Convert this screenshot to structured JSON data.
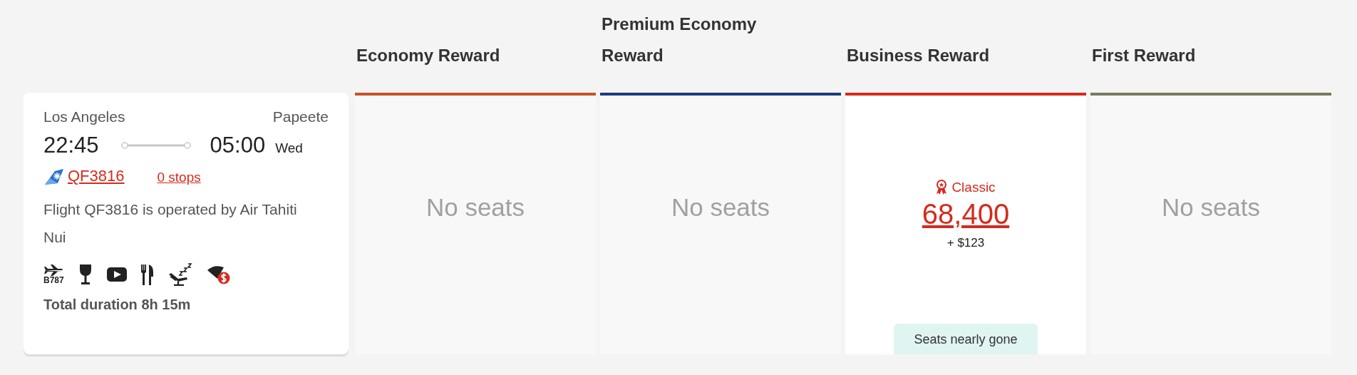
{
  "columns": [
    {
      "title": "Economy Reward",
      "color": "#c9522b"
    },
    {
      "title": "Premium Economy Reward",
      "color": "#1d3c7e"
    },
    {
      "title": "Business Reward",
      "color": "#d42b1e"
    },
    {
      "title": "First Reward",
      "color": "#7b7a5c"
    }
  ],
  "flight": {
    "origin": "Los Angeles",
    "destination": "Papeete",
    "depart_time": "22:45",
    "arrive_time": "05:00",
    "arrive_day": "Wed",
    "flight_number": "QF3816",
    "stops": "0 stops",
    "operated_by": "Flight QF3816 is operated by Air Tahiti Nui",
    "amenities": [
      {
        "kind": "aircraft",
        "label": "B787"
      },
      {
        "kind": "drink"
      },
      {
        "kind": "video"
      },
      {
        "kind": "meal"
      },
      {
        "kind": "sleep"
      },
      {
        "kind": "wifi_paid"
      }
    ],
    "total_duration": "Total duration 8h 15m"
  },
  "fares": [
    {
      "kind": "none",
      "text": "No seats"
    },
    {
      "kind": "none",
      "text": "No seats"
    },
    {
      "kind": "award",
      "label": "Classic",
      "points": "68,400",
      "cash": "+ $123",
      "badge": "Seats nearly gone"
    },
    {
      "kind": "none",
      "text": "No seats"
    }
  ]
}
